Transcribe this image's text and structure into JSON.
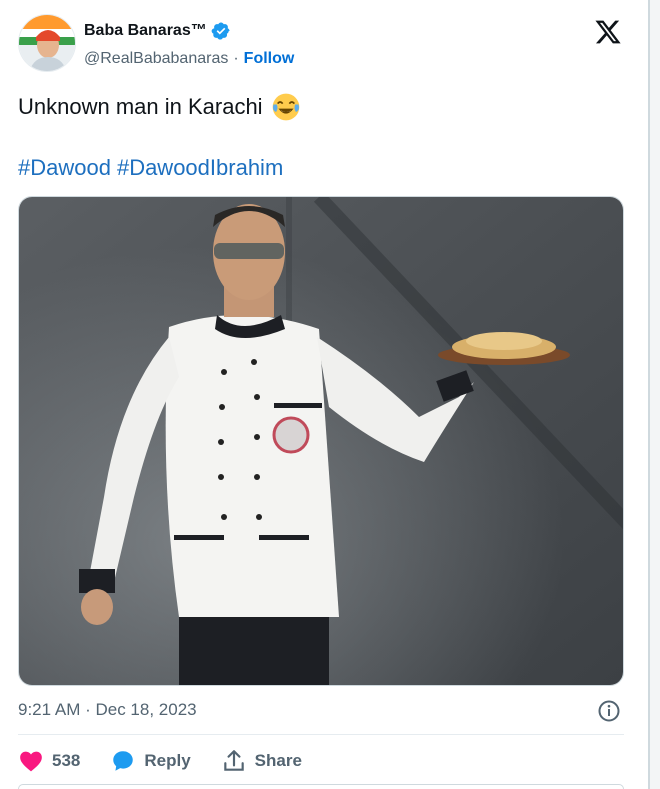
{
  "author": {
    "name": "Baba Banaras™",
    "handle": "@RealBababanaras",
    "separator": "·",
    "follow_label": "Follow"
  },
  "tweet": {
    "text": "Unknown man in Karachi",
    "emoji": "face-with-tears-of-joy",
    "hashtags": [
      "#Dawood",
      "#DawoodIbrahim"
    ]
  },
  "meta": {
    "timestamp": "9:21 AM · Dec 18, 2023"
  },
  "actions": {
    "likes": "538",
    "reply_label": "Reply",
    "share_label": "Share"
  },
  "icons": {
    "logo": "x-logo-icon",
    "verified": "verified-badge-icon",
    "info": "info-icon",
    "like": "heart-icon",
    "reply": "reply-bubble-icon",
    "share": "share-upload-icon"
  },
  "colors": {
    "accent": "#006fd6",
    "hashtag": "#1d6fbf",
    "like": "#f91880",
    "verified": "#1d9bf0",
    "muted": "#536471"
  }
}
